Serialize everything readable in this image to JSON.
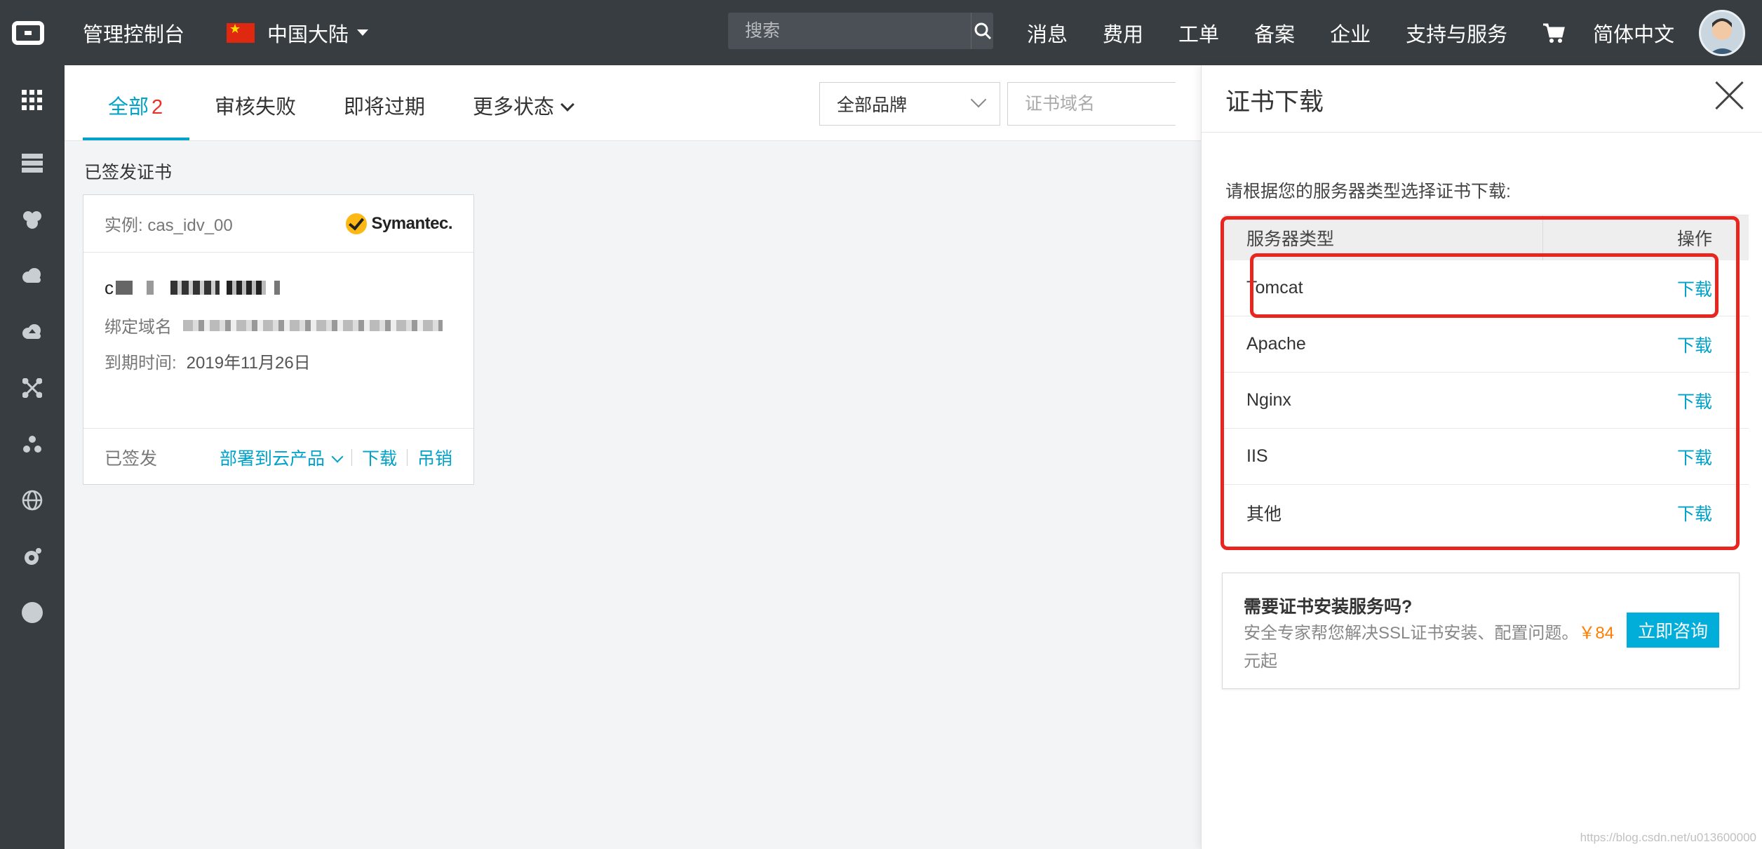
{
  "topbar": {
    "console_title": "管理控制台",
    "region": "中国大陆",
    "search_placeholder": "搜索",
    "nav": [
      "消息",
      "费用",
      "工单",
      "备案",
      "企业",
      "支持与服务"
    ],
    "language": "简体中文"
  },
  "leftbar": {
    "icons": [
      "grid-icon",
      "server-icon",
      "cluster-icon",
      "cloud-icon",
      "cloud-upload-icon",
      "network-icon",
      "share-nodes-icon",
      "globe-icon",
      "monitor-icon",
      "circle-icon"
    ]
  },
  "tabs": {
    "all_label": "全部",
    "all_count": "2",
    "review_failed": "审核失败",
    "expiring": "即将过期",
    "more_status": "更多状态"
  },
  "filters": {
    "brand": "全部品牌",
    "domain_placeholder": "证书域名"
  },
  "section_title": "已签发证书",
  "card": {
    "instance": "实例: cas_idv_00",
    "brand": "Symantec.",
    "cert_name_prefix": "c",
    "bound_domain_label": "绑定域名",
    "expiry_label": "到期时间:",
    "expiry_value": "2019年11月26日",
    "status": "已签发",
    "deploy": "部署到云产品",
    "download": "下载",
    "revoke": "吊销"
  },
  "drawer": {
    "title": "证书下载",
    "instruction": "请根据您的服务器类型选择证书下载:",
    "col_server": "服务器类型",
    "col_action": "操作",
    "rows": [
      {
        "server": "Tomcat",
        "action": "下载"
      },
      {
        "server": "Apache",
        "action": "下载"
      },
      {
        "server": "Nginx",
        "action": "下载"
      },
      {
        "server": "IIS",
        "action": "下载"
      },
      {
        "server": "其他",
        "action": "下载"
      }
    ],
    "service": {
      "title": "需要证书安装服务吗?",
      "desc": "安全专家帮您解决SSL证书安装、配置问题。",
      "price": "￥84",
      "unit": "元起",
      "button": "立即咨询"
    }
  },
  "colors": {
    "topbar": "#373d41",
    "accent": "#00a2ca",
    "highlight": "#e8261f",
    "price": "#ff7e00"
  },
  "watermark": "https://blog.csdn.net/u013600000"
}
